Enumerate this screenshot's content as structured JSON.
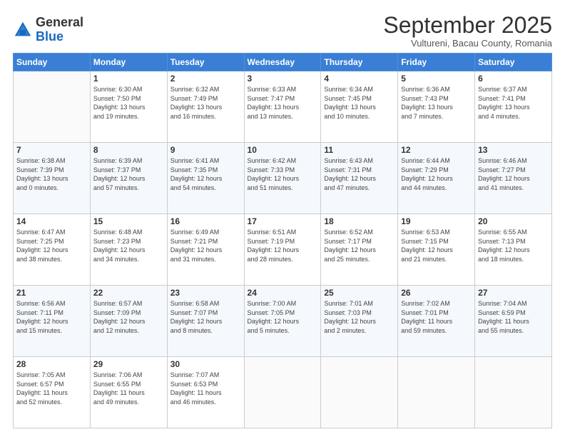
{
  "logo": {
    "general": "General",
    "blue": "Blue"
  },
  "title": "September 2025",
  "subtitle": "Vultureni, Bacau County, Romania",
  "days_header": [
    "Sunday",
    "Monday",
    "Tuesday",
    "Wednesday",
    "Thursday",
    "Friday",
    "Saturday"
  ],
  "weeks": [
    [
      {
        "num": "",
        "info": ""
      },
      {
        "num": "1",
        "info": "Sunrise: 6:30 AM\nSunset: 7:50 PM\nDaylight: 13 hours\nand 19 minutes."
      },
      {
        "num": "2",
        "info": "Sunrise: 6:32 AM\nSunset: 7:49 PM\nDaylight: 13 hours\nand 16 minutes."
      },
      {
        "num": "3",
        "info": "Sunrise: 6:33 AM\nSunset: 7:47 PM\nDaylight: 13 hours\nand 13 minutes."
      },
      {
        "num": "4",
        "info": "Sunrise: 6:34 AM\nSunset: 7:45 PM\nDaylight: 13 hours\nand 10 minutes."
      },
      {
        "num": "5",
        "info": "Sunrise: 6:36 AM\nSunset: 7:43 PM\nDaylight: 13 hours\nand 7 minutes."
      },
      {
        "num": "6",
        "info": "Sunrise: 6:37 AM\nSunset: 7:41 PM\nDaylight: 13 hours\nand 4 minutes."
      }
    ],
    [
      {
        "num": "7",
        "info": "Sunrise: 6:38 AM\nSunset: 7:39 PM\nDaylight: 13 hours\nand 0 minutes."
      },
      {
        "num": "8",
        "info": "Sunrise: 6:39 AM\nSunset: 7:37 PM\nDaylight: 12 hours\nand 57 minutes."
      },
      {
        "num": "9",
        "info": "Sunrise: 6:41 AM\nSunset: 7:35 PM\nDaylight: 12 hours\nand 54 minutes."
      },
      {
        "num": "10",
        "info": "Sunrise: 6:42 AM\nSunset: 7:33 PM\nDaylight: 12 hours\nand 51 minutes."
      },
      {
        "num": "11",
        "info": "Sunrise: 6:43 AM\nSunset: 7:31 PM\nDaylight: 12 hours\nand 47 minutes."
      },
      {
        "num": "12",
        "info": "Sunrise: 6:44 AM\nSunset: 7:29 PM\nDaylight: 12 hours\nand 44 minutes."
      },
      {
        "num": "13",
        "info": "Sunrise: 6:46 AM\nSunset: 7:27 PM\nDaylight: 12 hours\nand 41 minutes."
      }
    ],
    [
      {
        "num": "14",
        "info": "Sunrise: 6:47 AM\nSunset: 7:25 PM\nDaylight: 12 hours\nand 38 minutes."
      },
      {
        "num": "15",
        "info": "Sunrise: 6:48 AM\nSunset: 7:23 PM\nDaylight: 12 hours\nand 34 minutes."
      },
      {
        "num": "16",
        "info": "Sunrise: 6:49 AM\nSunset: 7:21 PM\nDaylight: 12 hours\nand 31 minutes."
      },
      {
        "num": "17",
        "info": "Sunrise: 6:51 AM\nSunset: 7:19 PM\nDaylight: 12 hours\nand 28 minutes."
      },
      {
        "num": "18",
        "info": "Sunrise: 6:52 AM\nSunset: 7:17 PM\nDaylight: 12 hours\nand 25 minutes."
      },
      {
        "num": "19",
        "info": "Sunrise: 6:53 AM\nSunset: 7:15 PM\nDaylight: 12 hours\nand 21 minutes."
      },
      {
        "num": "20",
        "info": "Sunrise: 6:55 AM\nSunset: 7:13 PM\nDaylight: 12 hours\nand 18 minutes."
      }
    ],
    [
      {
        "num": "21",
        "info": "Sunrise: 6:56 AM\nSunset: 7:11 PM\nDaylight: 12 hours\nand 15 minutes."
      },
      {
        "num": "22",
        "info": "Sunrise: 6:57 AM\nSunset: 7:09 PM\nDaylight: 12 hours\nand 12 minutes."
      },
      {
        "num": "23",
        "info": "Sunrise: 6:58 AM\nSunset: 7:07 PM\nDaylight: 12 hours\nand 8 minutes."
      },
      {
        "num": "24",
        "info": "Sunrise: 7:00 AM\nSunset: 7:05 PM\nDaylight: 12 hours\nand 5 minutes."
      },
      {
        "num": "25",
        "info": "Sunrise: 7:01 AM\nSunset: 7:03 PM\nDaylight: 12 hours\nand 2 minutes."
      },
      {
        "num": "26",
        "info": "Sunrise: 7:02 AM\nSunset: 7:01 PM\nDaylight: 11 hours\nand 59 minutes."
      },
      {
        "num": "27",
        "info": "Sunrise: 7:04 AM\nSunset: 6:59 PM\nDaylight: 11 hours\nand 55 minutes."
      }
    ],
    [
      {
        "num": "28",
        "info": "Sunrise: 7:05 AM\nSunset: 6:57 PM\nDaylight: 11 hours\nand 52 minutes."
      },
      {
        "num": "29",
        "info": "Sunrise: 7:06 AM\nSunset: 6:55 PM\nDaylight: 11 hours\nand 49 minutes."
      },
      {
        "num": "30",
        "info": "Sunrise: 7:07 AM\nSunset: 6:53 PM\nDaylight: 11 hours\nand 46 minutes."
      },
      {
        "num": "",
        "info": ""
      },
      {
        "num": "",
        "info": ""
      },
      {
        "num": "",
        "info": ""
      },
      {
        "num": "",
        "info": ""
      }
    ]
  ]
}
